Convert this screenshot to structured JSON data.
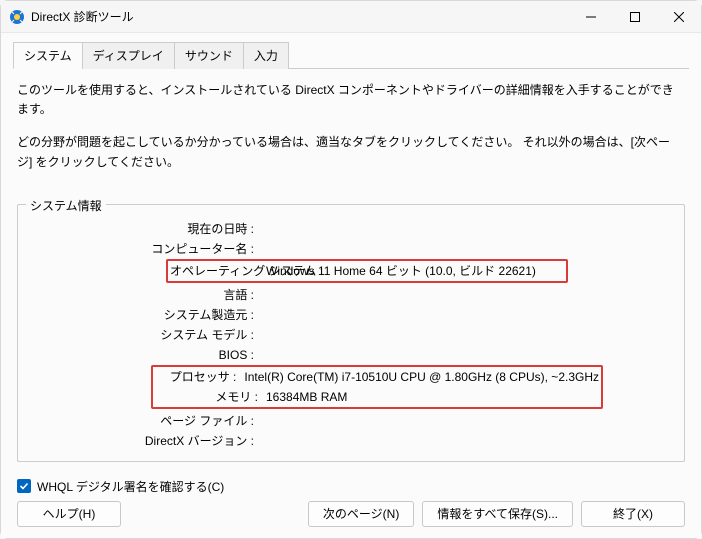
{
  "window": {
    "title": "DirectX 診断ツール"
  },
  "tabs": {
    "system": "システム",
    "display": "ディスプレイ",
    "sound": "サウンド",
    "input": "入力"
  },
  "description": {
    "line1": "このツールを使用すると、インストールされている DirectX コンポーネントやドライバーの詳細情報を入手することができます。",
    "line2": "どの分野が問題を起こしているか分かっている場合は、適当なタブをクリックしてください。 それ以外の場合は、[次ページ] をクリックしてください。"
  },
  "group": {
    "title": "システム情報",
    "rows": {
      "datetime": {
        "label": "現在の日時 :",
        "value": ""
      },
      "computer_name": {
        "label": "コンピューター名 :",
        "value": ""
      },
      "os": {
        "label": "オペレーティング システム :",
        "value": "Windows 11 Home 64 ビット (10.0, ビルド 22621)"
      },
      "language": {
        "label": "言語 :",
        "value": ""
      },
      "manufacturer": {
        "label": "システム製造元 :",
        "value": ""
      },
      "model": {
        "label": "システム モデル :",
        "value": ""
      },
      "bios": {
        "label": "BIOS :",
        "value": ""
      },
      "processor": {
        "label": "プロセッサ :",
        "value": "Intel(R) Core(TM) i7-10510U CPU @ 1.80GHz (8 CPUs), ~2.3GHz"
      },
      "memory": {
        "label": "メモリ :",
        "value": "16384MB RAM"
      },
      "pagefile": {
        "label": "ページ ファイル :",
        "value": ""
      },
      "directx_version": {
        "label": "DirectX バージョン :",
        "value": ""
      }
    }
  },
  "checkbox": {
    "label": "WHQL デジタル署名を確認する(C)",
    "checked": true
  },
  "buttons": {
    "help": "ヘルプ(H)",
    "next": "次のページ(N)",
    "saveall": "情報をすべて保存(S)...",
    "exit": "終了(X)"
  }
}
